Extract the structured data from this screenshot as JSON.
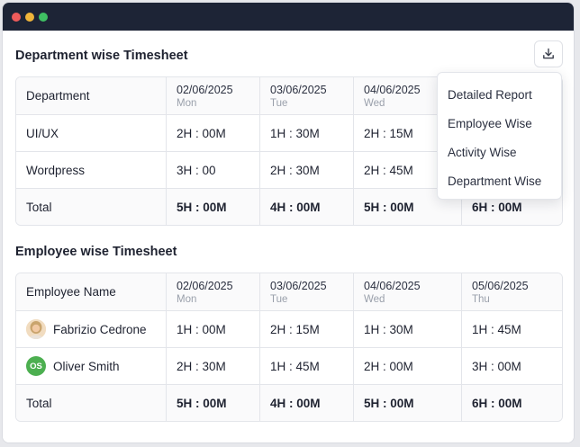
{
  "window": {
    "controls": [
      "close",
      "minimize",
      "maximize"
    ]
  },
  "dept_section": {
    "title": "Department wise Timesheet",
    "header": {
      "label": "Department",
      "dates": [
        {
          "date": "02/06/2025",
          "day": "Mon"
        },
        {
          "date": "03/06/2025",
          "day": "Tue"
        },
        {
          "date": "04/06/2025",
          "day": "Wed"
        }
      ]
    },
    "rows": [
      {
        "name": "UI/UX",
        "values": [
          "2H : 00M",
          "1H : 30M",
          "2H : 15M"
        ]
      },
      {
        "name": "Wordpress",
        "values": [
          "3H : 00",
          "2H : 30M",
          "2H : 45M"
        ]
      }
    ],
    "total": {
      "label": "Total",
      "values": [
        "5H : 00M",
        "4H : 00M",
        "5H : 00M",
        "6H : 00M"
      ]
    }
  },
  "emp_section": {
    "title": "Employee wise Timesheet",
    "header": {
      "label": "Employee Name",
      "dates": [
        {
          "date": "02/06/2025",
          "day": "Mon"
        },
        {
          "date": "03/06/2025",
          "day": "Tue"
        },
        {
          "date": "04/06/2025",
          "day": "Wed"
        },
        {
          "date": "05/06/2025",
          "day": "Thu"
        }
      ]
    },
    "rows": [
      {
        "name": "Fabrizio Cedrone",
        "avatar": "photo",
        "values": [
          "1H : 00M",
          "2H : 15M",
          "1H : 30M",
          "1H : 45M"
        ]
      },
      {
        "name": "Oliver Smith",
        "avatar": "OS",
        "avatar_color": "#4caf50",
        "values": [
          "2H : 30M",
          "1H : 45M",
          "2H : 00M",
          "3H : 00M"
        ]
      }
    ],
    "total": {
      "label": "Total",
      "values": [
        "5H : 00M",
        "4H : 00M",
        "5H : 00M",
        "6H : 00M"
      ]
    }
  },
  "toolbar": {
    "download_icon": "download-icon"
  },
  "dropdown": {
    "items": [
      "Detailed Report",
      "Employee Wise",
      "Activity Wise",
      "Department Wise"
    ]
  },
  "colors": {
    "titlebar": "#1d2436",
    "close": "#ee5b5b",
    "minimize": "#f0b53a",
    "maximize": "#3fbf63"
  }
}
